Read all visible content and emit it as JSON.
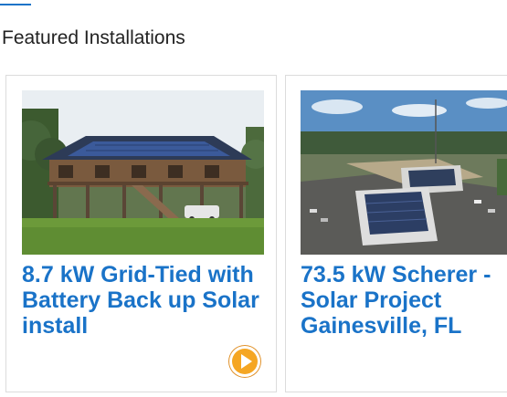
{
  "section": {
    "title": "Featured Installations"
  },
  "cards": [
    {
      "title": "8.7 kW Grid-Tied with Battery Back up Solar install",
      "image": "house-with-solar-roof-photo",
      "action_icon": "play-arrow-icon"
    },
    {
      "title": "73.5 kW Scherer - Solar Project Gainesville, FL",
      "image": "aerial-commercial-solar-photo"
    }
  ],
  "colors": {
    "link": "#1a73c8",
    "accent": "#f5a623",
    "heading": "#222222",
    "card_border": "#dcdcdc"
  }
}
